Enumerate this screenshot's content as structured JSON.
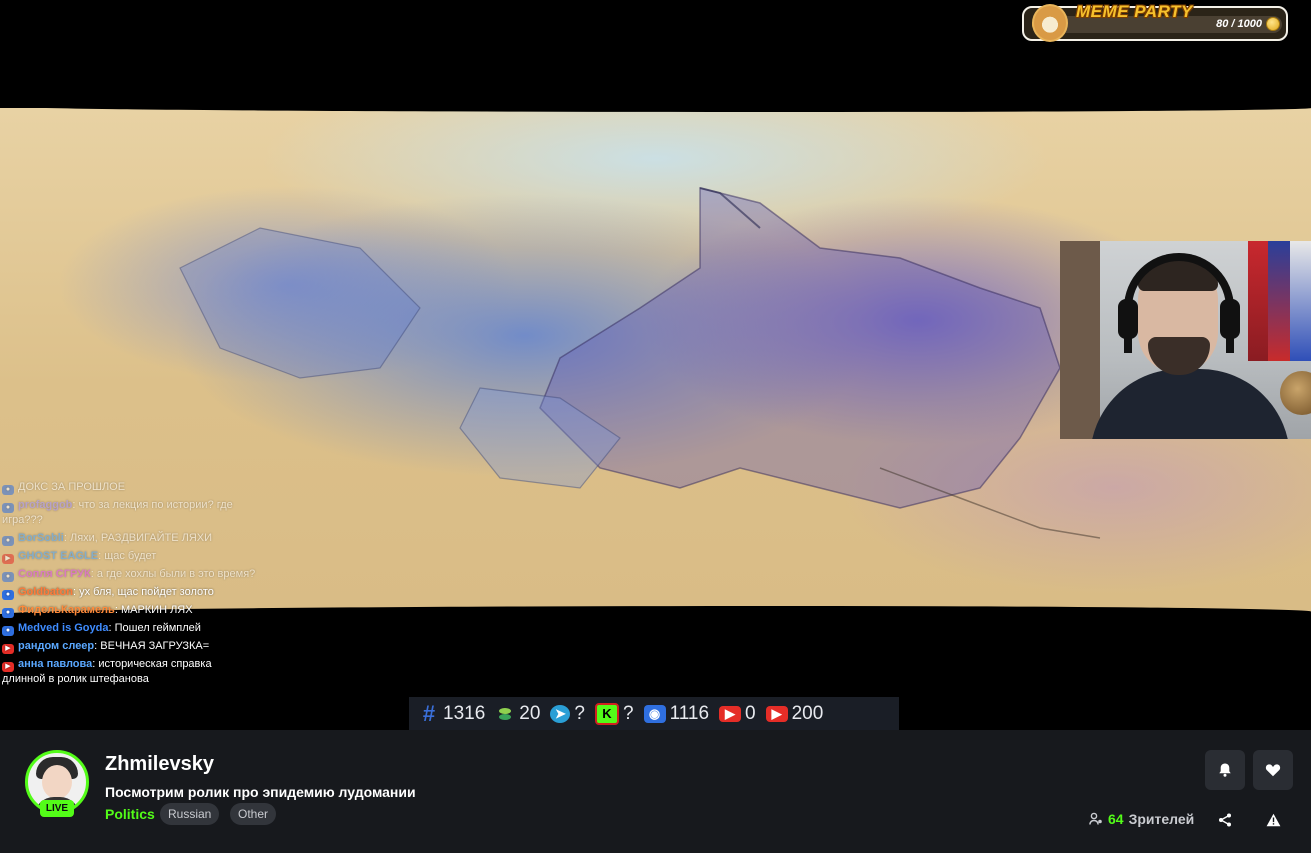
{
  "overlay": {
    "meme_party": {
      "title": "MEME PARTY",
      "count": "80 / 1000",
      "progress_fraction": 0.08
    },
    "chat": {
      "messages": [
        {
          "platform": "vk",
          "user": "",
          "text": "ДОКС ЗА ПРОШЛОЕ",
          "user_color": "#a0a0a0",
          "faded": true
        },
        {
          "platform": "vk",
          "user": "profaggob",
          "text": "что за лекция по истории? где игра???",
          "user_color": "#9b8cff",
          "faded": true
        },
        {
          "platform": "vk",
          "user": "BorSobli",
          "text": "Ляхи, РАЗДВИГАЙТЕ ЛЯХИ",
          "user_color": "#3fa0ff",
          "faded": true
        },
        {
          "platform": "yt",
          "user": "GHOST EAGLE",
          "text": "щас будет",
          "user_color": "#3fa0ff",
          "faded": true
        },
        {
          "platform": "vk",
          "user": "Сопля СГРУК",
          "text": "а где хохлы были в это время?",
          "user_color": "#d946ef",
          "faded": true
        },
        {
          "platform": "vk",
          "user": "Goldbaton",
          "text": "ух бля, щас пойдет золото",
          "user_color": "#ff7a3a",
          "faded": false
        },
        {
          "platform": "vk",
          "user": "ФидельКарамель",
          "text": "МАРКИН ЛЯХ",
          "user_color": "#ff8a3a",
          "faded": false
        },
        {
          "platform": "vk",
          "user": "Medved is Goyda",
          "text": "Пошел геймплей",
          "user_color": "#3f8cff",
          "faded": false
        },
        {
          "platform": "yt",
          "user": "рандом слеер",
          "text": "ВЕЧНАЯ ЗАГРУЗКА=",
          "user_color": "#5aa8ff",
          "faded": false
        },
        {
          "platform": "yt",
          "user": "анна павлова",
          "text": "историческая справка длинной в ролик штефанова",
          "user_color": "#5aa8ff",
          "faded": false
        }
      ]
    },
    "stats": [
      {
        "icon": "hash-icon",
        "value": "1316"
      },
      {
        "icon": "discord-icon",
        "value": "20"
      },
      {
        "icon": "telegram-icon",
        "value": "?"
      },
      {
        "icon": "kick-icon",
        "value": "?"
      },
      {
        "icon": "vk-video-icon",
        "value": "1116"
      },
      {
        "icon": "youtube-icon",
        "value": "0"
      },
      {
        "icon": "youtube-icon",
        "value": "200"
      }
    ]
  },
  "channel": {
    "name": "Zhmilevsky",
    "live_label": "LIVE",
    "stream_title": "Посмотрим ролик про эпидемию лудомании",
    "category": "Politics",
    "tags": [
      "Russian",
      "Other"
    ],
    "viewers_count": "64",
    "viewers_label": "Зрителей"
  },
  "colors": {
    "accent": "#53fc18",
    "bar_bg": "#17191d",
    "button_bg": "#2a2d33"
  }
}
